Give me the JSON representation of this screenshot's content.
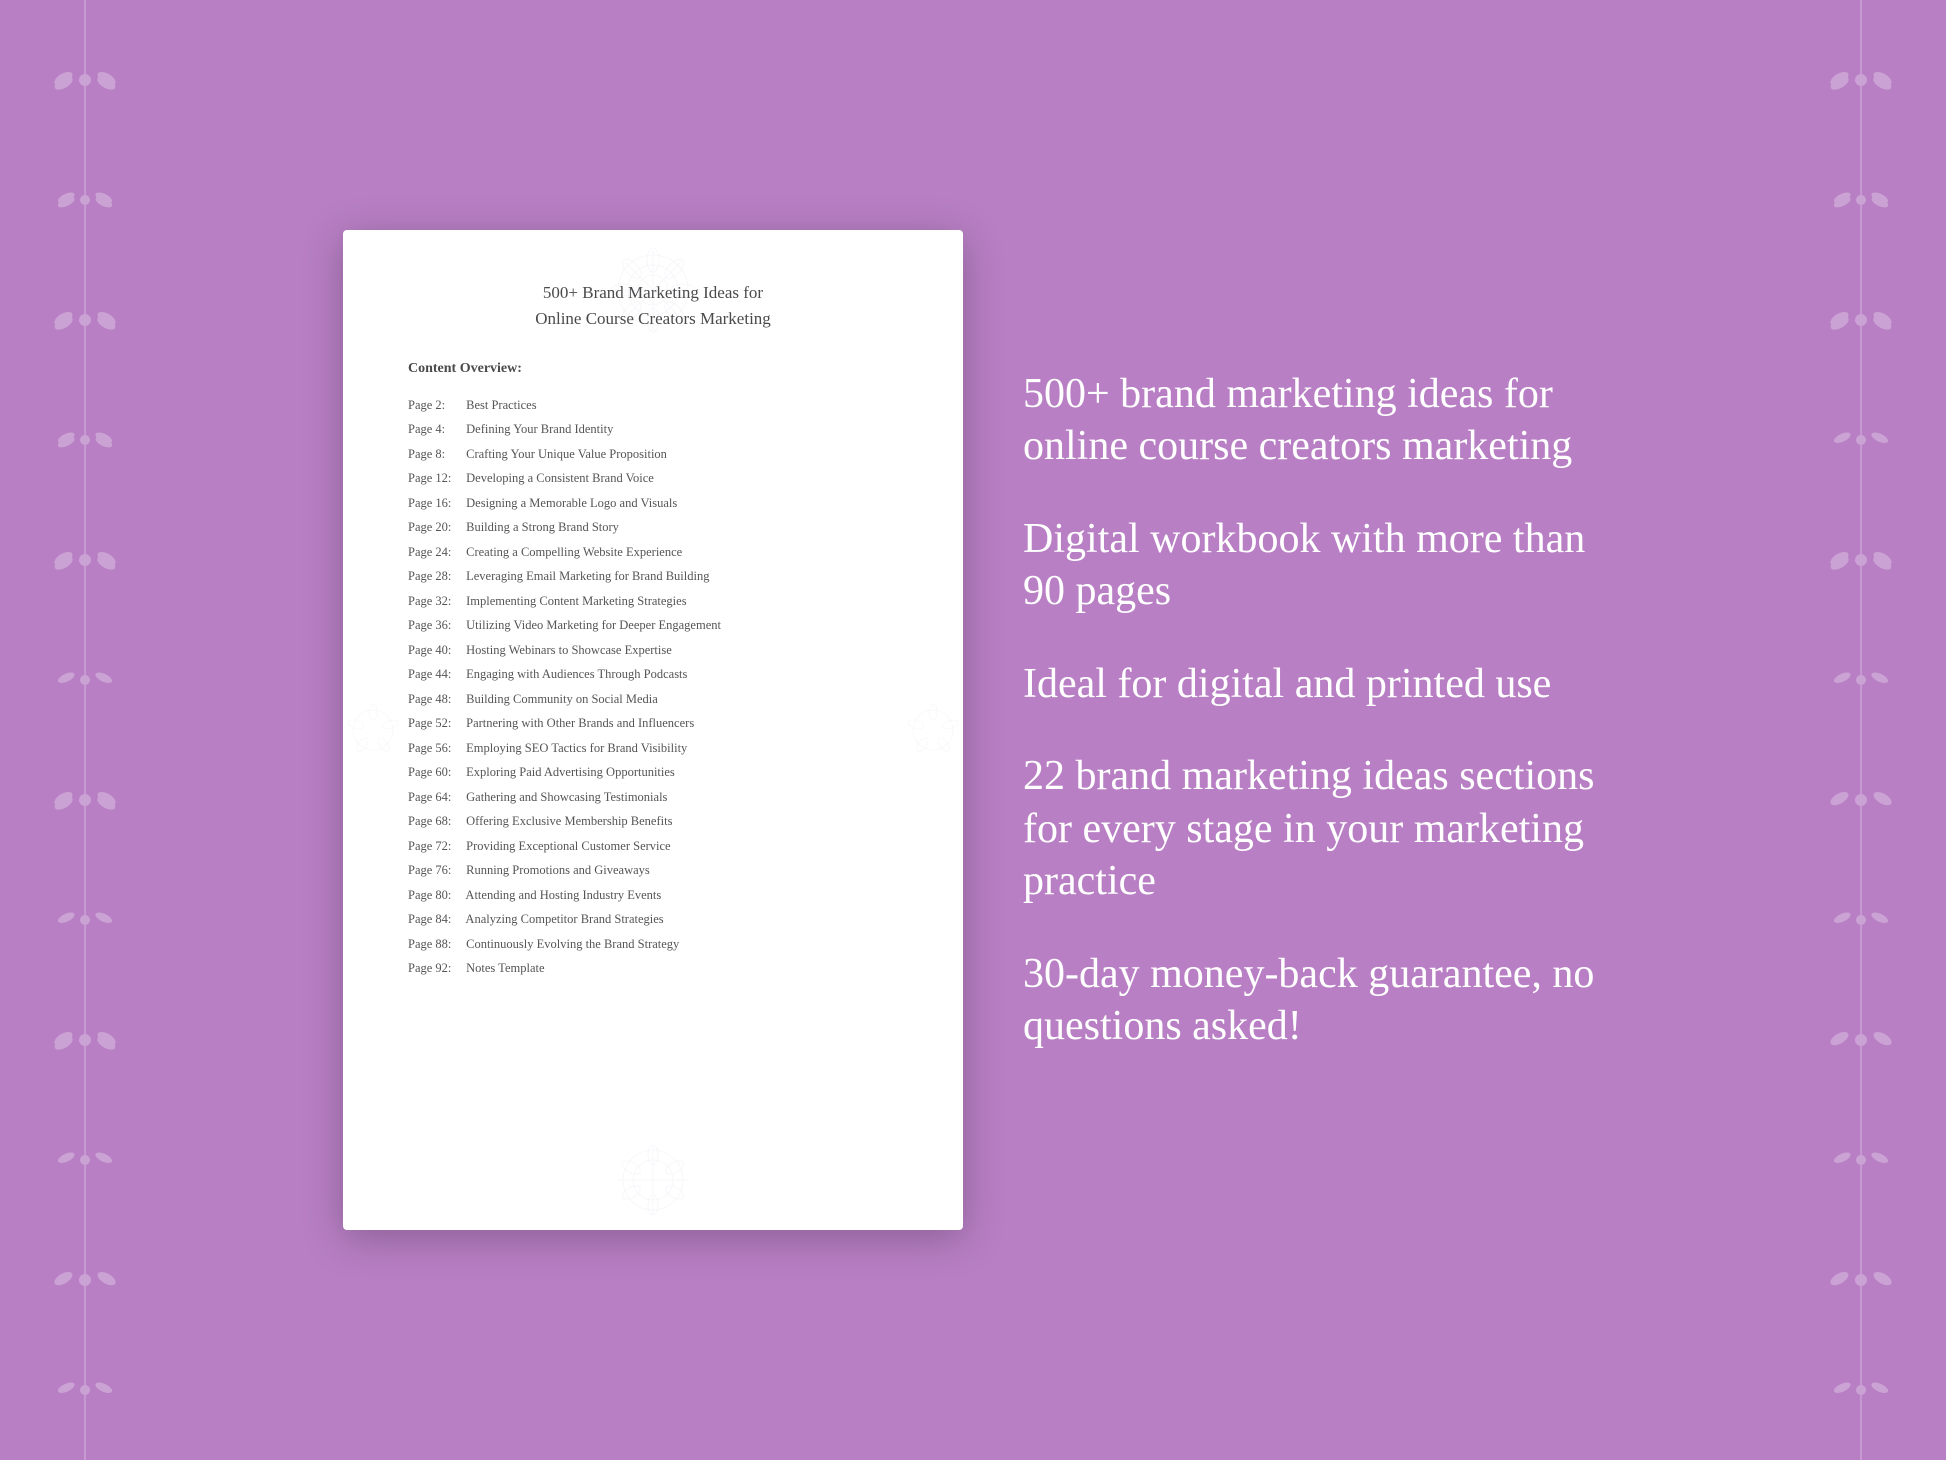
{
  "background_color": "#b87fc4",
  "left_border": {
    "aria": "decorative floral border left"
  },
  "right_border": {
    "aria": "decorative floral border right"
  },
  "document": {
    "title_line1": "500+ Brand Marketing Ideas for",
    "title_line2": "Online Course Creators Marketing",
    "content_overview_label": "Content Overview:",
    "toc_items": [
      {
        "page": "Page  2:",
        "title": "Best Practices"
      },
      {
        "page": "Page  4:",
        "title": "Defining Your Brand Identity"
      },
      {
        "page": "Page  8:",
        "title": "Crafting Your Unique Value Proposition"
      },
      {
        "page": "Page 12:",
        "title": "Developing a Consistent Brand Voice"
      },
      {
        "page": "Page 16:",
        "title": "Designing a Memorable Logo and Visuals"
      },
      {
        "page": "Page 20:",
        "title": "Building a Strong Brand Story"
      },
      {
        "page": "Page 24:",
        "title": "Creating a Compelling Website Experience"
      },
      {
        "page": "Page 28:",
        "title": "Leveraging Email Marketing for Brand Building"
      },
      {
        "page": "Page 32:",
        "title": "Implementing Content Marketing Strategies"
      },
      {
        "page": "Page 36:",
        "title": "Utilizing Video Marketing for Deeper Engagement"
      },
      {
        "page": "Page 40:",
        "title": "Hosting Webinars to Showcase Expertise"
      },
      {
        "page": "Page 44:",
        "title": "Engaging with Audiences Through Podcasts"
      },
      {
        "page": "Page 48:",
        "title": "Building Community on Social Media"
      },
      {
        "page": "Page 52:",
        "title": "Partnering with Other Brands and Influencers"
      },
      {
        "page": "Page 56:",
        "title": "Employing SEO Tactics for Brand Visibility"
      },
      {
        "page": "Page 60:",
        "title": "Exploring Paid Advertising Opportunities"
      },
      {
        "page": "Page 64:",
        "title": "Gathering and Showcasing Testimonials"
      },
      {
        "page": "Page 68:",
        "title": "Offering Exclusive Membership Benefits"
      },
      {
        "page": "Page 72:",
        "title": "Providing Exceptional Customer Service"
      },
      {
        "page": "Page 76:",
        "title": "Running Promotions and Giveaways"
      },
      {
        "page": "Page 80:",
        "title": "Attending and Hosting Industry Events"
      },
      {
        "page": "Page 84:",
        "title": "Analyzing Competitor Brand Strategies"
      },
      {
        "page": "Page 88:",
        "title": "Continuously Evolving the Brand Strategy"
      },
      {
        "page": "Page 92:",
        "title": "Notes Template"
      }
    ]
  },
  "features": [
    {
      "id": "feature-1",
      "text": "500+ brand marketing ideas for online course creators marketing"
    },
    {
      "id": "feature-2",
      "text": "Digital workbook with more than 90 pages"
    },
    {
      "id": "feature-3",
      "text": "Ideal for digital and printed use"
    },
    {
      "id": "feature-4",
      "text": "22 brand marketing ideas sections for every stage in your marketing practice"
    },
    {
      "id": "feature-5",
      "text": "30-day money-back guarantee, no questions asked!"
    }
  ]
}
